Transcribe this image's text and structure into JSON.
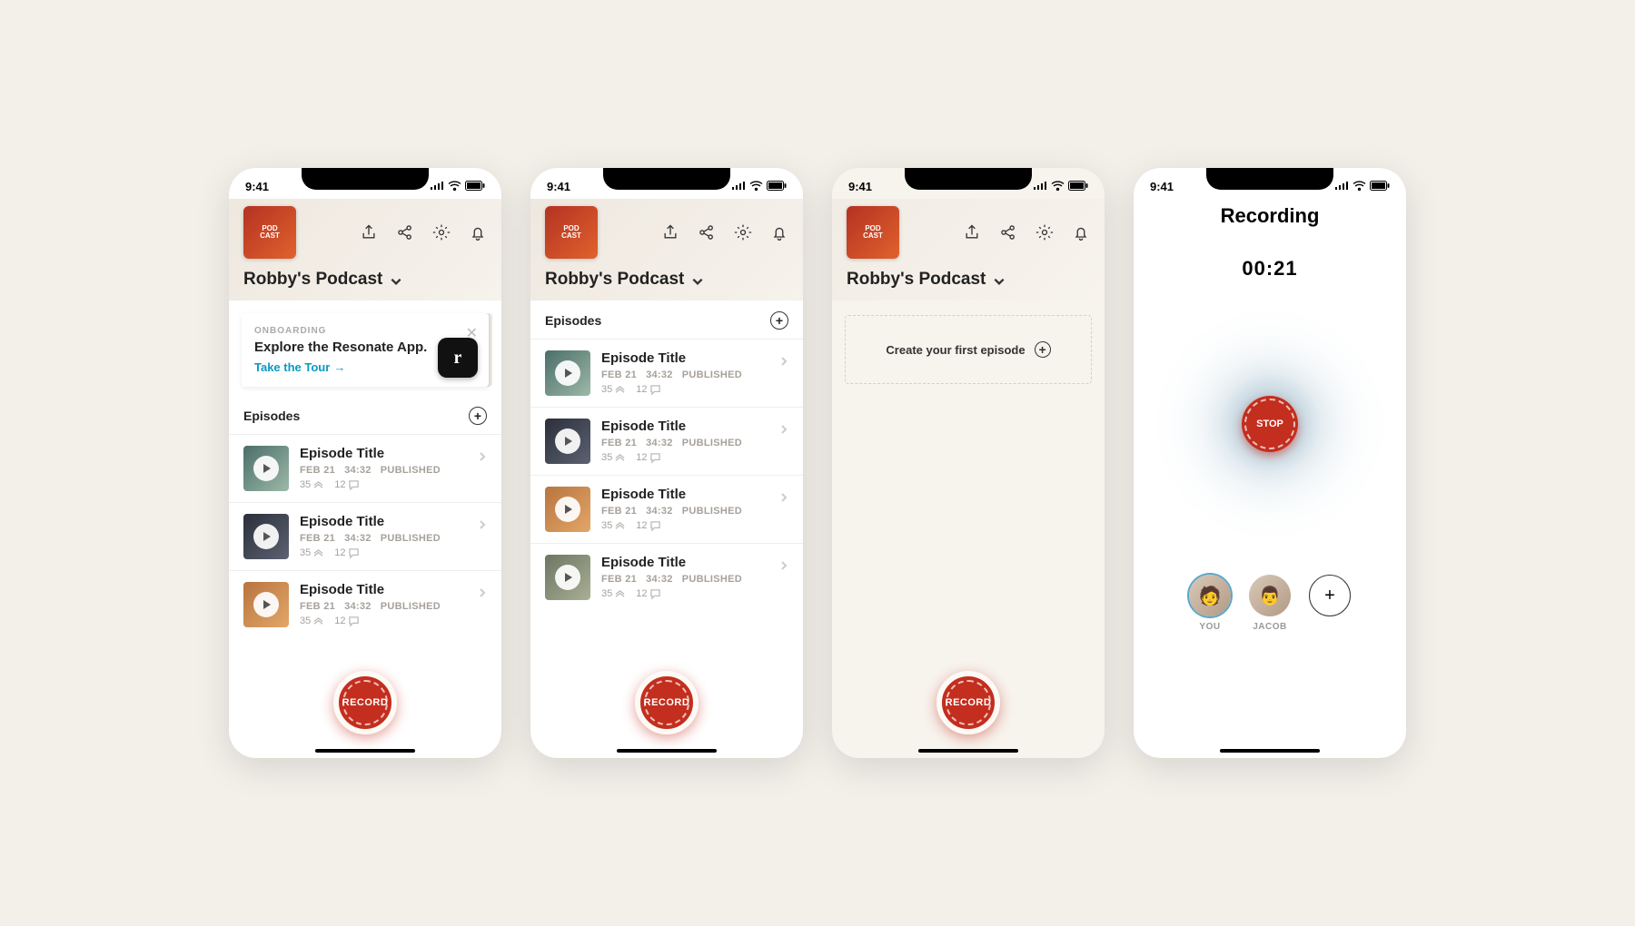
{
  "status": {
    "time": "9:41"
  },
  "podcast_title": "Robby's Podcast",
  "header_icons": [
    "share-icon",
    "share-network-icon",
    "gear-icon",
    "bell-icon"
  ],
  "onboarding": {
    "eyebrow": "ONBOARDING",
    "headline": "Explore the Resonate App.",
    "link": "Take the Tour"
  },
  "episodes_label": "Episodes",
  "episode": {
    "title": "Episode Title",
    "date": "FEB 21",
    "duration": "34:32",
    "status": "PUBLISHED",
    "plays": "35",
    "comments": "12"
  },
  "record_label": "RECORD",
  "stop_label": "STOP",
  "empty_cta": "Create your first episode",
  "recording": {
    "title": "Recording",
    "time": "00:21",
    "participants": [
      {
        "label": "YOU",
        "active": true
      },
      {
        "label": "JACOB",
        "active": false
      }
    ]
  },
  "thumb_colors": [
    [
      "#4a6e68",
      "#9db9a8"
    ],
    [
      "#2b2f3a",
      "#5c6272"
    ],
    [
      "#b8753f",
      "#e3a668"
    ],
    [
      "#6d7461",
      "#a9b096"
    ]
  ]
}
